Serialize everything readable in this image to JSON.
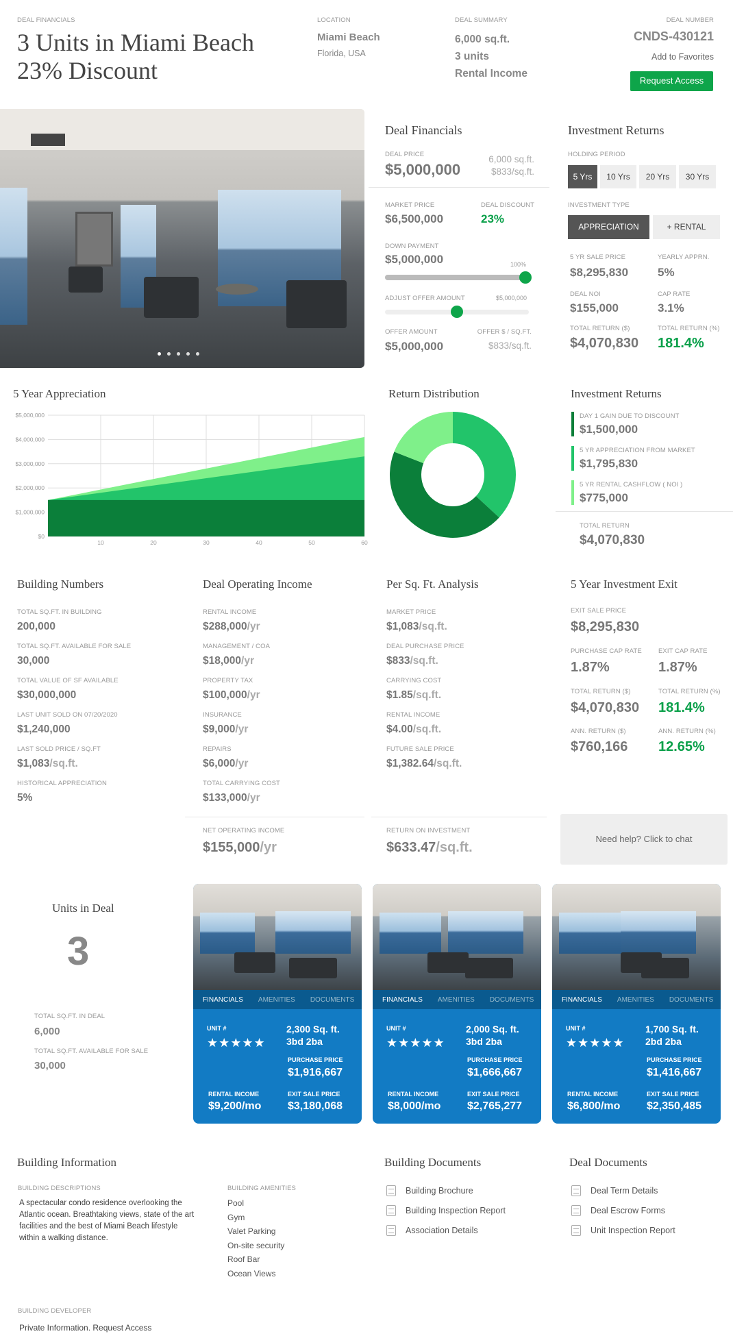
{
  "header": {
    "section_label": "DEAL FINANCIALS",
    "title_line1": "3 Units in Miami Beach",
    "title_line2": "23% Discount",
    "location_label": "LOCATION",
    "location_city": "Miami Beach",
    "location_region": "Florida, USA",
    "summary_label": "DEAL SUMMARY",
    "summary_sqft": "6,000 sq.ft.",
    "summary_units": "3 units",
    "summary_type": "Rental Income",
    "deal_number_label": "DEAL NUMBER",
    "deal_number": "CNDS-430121",
    "favorites_link": "Add to Favorites",
    "request_access": "Request Access"
  },
  "deal_financials": {
    "title": "Deal Financials",
    "deal_price_label": "DEAL PRICE",
    "deal_price": "$5,000,000",
    "sqft": "6,000 sq.ft.",
    "per_sqft": "$833/sq.ft.",
    "market_price_label": "MARKET PRICE",
    "market_price": "$6,500,000",
    "discount_label": "DEAL DISCOUNT",
    "discount": "23%",
    "down_payment_label": "DOWN PAYMENT",
    "down_payment": "$5,000,000",
    "down_payment_pct": "100%",
    "down_payment_level": 1.0,
    "adjust_offer_label": "ADJUST OFFER AMOUNT",
    "adjust_offer_max": "$5,000,000",
    "adjust_offer_level": 0.5,
    "offer_amount_label": "OFFER AMOUNT",
    "offer_amount": "$5,000,000",
    "offer_per_sqft_label": "OFFER $ / SQ.FT.",
    "offer_per_sqft": "$833/sq.ft."
  },
  "investment_returns": {
    "title": "Investment Returns",
    "holding_label": "HOLDING PERIOD",
    "holding_options": [
      "5 Yrs",
      "10 Yrs",
      "20 Yrs",
      "30 Yrs"
    ],
    "type_label": "INVESTMENT TYPE",
    "type_options": [
      "APPRECIATION",
      "+ RENTAL"
    ],
    "sale_price_label": "5 YR SALE PRICE",
    "sale_price": "$8,295,830",
    "yearly_appr_label": "YEARLY APPRN.",
    "yearly_appr": "5%",
    "noi_label": "DEAL NOI",
    "noi": "$155,000",
    "cap_rate_label": "CAP RATE",
    "cap_rate": "3.1%",
    "total_return_label": "TOTAL RETURN ($)",
    "total_return": "$4,070,830",
    "total_return_pct_label": "TOTAL RETURN (%)",
    "total_return_pct": "181.4%"
  },
  "appreciation_chart": {
    "title": "5 Year Appreciation"
  },
  "chart_data": [
    {
      "type": "area",
      "title": "5 Year Appreciation",
      "x": [
        0,
        60
      ],
      "xticks": [
        "10",
        "20",
        "30",
        "40",
        "50",
        "60"
      ],
      "yticks": [
        "$0",
        "$1,000,000",
        "$2,000,000",
        "$3,000,000",
        "$4,000,000",
        "$5,000,000"
      ],
      "ylim": [
        0,
        5000000
      ],
      "xlim": [
        0,
        60
      ],
      "series": [
        {
          "values": [
            1500000,
            1500000
          ],
          "color": "#0b7f3a"
        },
        {
          "values": [
            1500000,
            3300000
          ],
          "color": "#22c46a"
        },
        {
          "values": [
            1500000,
            4100000
          ],
          "color": "#7ff08a"
        }
      ],
      "grid": true
    },
    {
      "type": "pie",
      "title": "Return Distribution",
      "values": [
        1500000,
        1795830,
        775000
      ],
      "colors": [
        "#22c46a",
        "#0b7f3a",
        "#7ff08a"
      ]
    }
  ],
  "return_distribution": {
    "title": "Return Distribution"
  },
  "returns_breakdown": {
    "title": "Investment Returns",
    "items": [
      {
        "label": "DAY 1 GAIN DUE TO DISCOUNT",
        "value": "$1,500,000",
        "color": "#0b7f3a"
      },
      {
        "label": "5 YR APPRECIATION FROM MARKET",
        "value": "$1,795,830",
        "color": "#22c46a"
      },
      {
        "label": "5 YR RENTAL CASHFLOW ( NOI )",
        "value": "$775,000",
        "color": "#7ff08a"
      }
    ],
    "total_label": "TOTAL RETURN",
    "total": "$4,070,830"
  },
  "building_numbers": {
    "title": "Building Numbers",
    "items": [
      {
        "label": "TOTAL SQ.FT. IN BUILDING",
        "value": "200,000",
        "unit": ""
      },
      {
        "label": "TOTAL SQ.FT. AVAILABLE FOR SALE",
        "value": "30,000",
        "unit": ""
      },
      {
        "label": "TOTAL VALUE OF SF AVAILABLE",
        "value": "$30,000,000",
        "unit": ""
      },
      {
        "label": "LAST UNIT SOLD ON 07/20/2020",
        "value": "$1,240,000",
        "unit": ""
      },
      {
        "label": "LAST SOLD PRICE / SQ.FT",
        "value": "$1,083",
        "unit": "/sq.ft."
      },
      {
        "label": "HISTORICAL APPRECIATION",
        "value": "5%",
        "unit": ""
      }
    ]
  },
  "operating_income": {
    "title": "Deal Operating Income",
    "items": [
      {
        "label": "RENTAL INCOME",
        "value": "$288,000",
        "unit": "/yr"
      },
      {
        "label": "MANAGEMENT / COA",
        "value": "$18,000",
        "unit": "/yr"
      },
      {
        "label": "PROPERTY TAX",
        "value": "$100,000",
        "unit": "/yr"
      },
      {
        "label": "INSURANCE",
        "value": "$9,000",
        "unit": "/yr"
      },
      {
        "label": "REPAIRS",
        "value": "$6,000",
        "unit": "/yr"
      },
      {
        "label": "TOTAL CARRYING COST",
        "value": "$133,000",
        "unit": "/yr"
      }
    ],
    "noi_label": "NET OPERATING INCOME",
    "noi": "$155,000",
    "noi_unit": "/yr"
  },
  "sqft_analysis": {
    "title": "Per Sq. Ft. Analysis",
    "items": [
      {
        "label": "MARKET PRICE",
        "value": "$1,083",
        "unit": "/sq.ft."
      },
      {
        "label": "DEAL PURCHASE PRICE",
        "value": "$833",
        "unit": "/sq.ft."
      },
      {
        "label": "CARRYING COST",
        "value": "$1.85",
        "unit": "/sq.ft."
      },
      {
        "label": "RENTAL INCOME",
        "value": "$4.00",
        "unit": "/sq.ft."
      },
      {
        "label": "FUTURE SALE PRICE",
        "value": "$1,382.64",
        "unit": "/sq.ft."
      }
    ],
    "roi_label": "RETURN ON INVESTMENT",
    "roi": "$633.47",
    "roi_unit": "/sq.ft."
  },
  "exit": {
    "title": "5 Year Investment Exit",
    "exit_price_label": "EXIT SALE PRICE",
    "exit_price": "$8,295,830",
    "purchase_cap_label": "PURCHASE CAP RATE",
    "purchase_cap": "1.87%",
    "exit_cap_label": "EXIT CAP RATE",
    "exit_cap": "1.87%",
    "total_return_label": "TOTAL RETURN ($)",
    "total_return": "$4,070,830",
    "total_return_pct_label": "TOTAL RETURN (%)",
    "total_return_pct": "181.4%",
    "ann_return_label": "ANN. RETURN ($)",
    "ann_return": "$760,166",
    "ann_return_pct_label": "ANN. RETURN (%)",
    "ann_return_pct": "12.65%"
  },
  "chat": {
    "label": "Need help? Click to chat"
  },
  "units": {
    "title": "Units in Deal",
    "count": "3",
    "sqft_label": "TOTAL SQ.FT. IN DEAL",
    "sqft": "6,000",
    "available_label": "TOTAL SQ.FT. AVAILABLE FOR SALE",
    "available": "30,000",
    "tabs": [
      "FINANCIALS",
      "AMENITIES",
      "DOCUMENTS"
    ],
    "unit_label": "UNIT #",
    "stars": "★★★★★",
    "purchase_label": "PURCHASE PRICE",
    "rental_label": "RENTAL INCOME",
    "exit_label": "EXIT SALE PRICE",
    "cards": [
      {
        "size": "2,300 Sq. ft.",
        "rooms": "3bd 2ba",
        "purchase": "$1,916,667",
        "rental": "$9,200/mo",
        "exit": "$3,180,068"
      },
      {
        "size": "2,000 Sq. ft.",
        "rooms": "3bd 2ba",
        "purchase": "$1,666,667",
        "rental": "$8,000/mo",
        "exit": "$2,765,277"
      },
      {
        "size": "1,700 Sq. ft.",
        "rooms": "2bd 2ba",
        "purchase": "$1,416,667",
        "rental": "$6,800/mo",
        "exit": "$2,350,485"
      }
    ]
  },
  "building_info": {
    "title": "Building Information",
    "desc_label": "BUILDING DESCRIPTIONS",
    "desc": "A spectacular condo residence overlooking the Atlantic ocean. Breathtaking views, state of the art facilities and the best of Miami Beach lifestyle within a walking distance.",
    "amenities_label": "BUILDING AMENITIES",
    "amenities": [
      "Pool",
      "Gym",
      "Valet Parking",
      "On-site security",
      "Roof Bar",
      "Ocean Views"
    ],
    "developer_label": "BUILDING DEVELOPER",
    "developer": "Private Information. Request Access"
  },
  "building_docs": {
    "title": "Building Documents",
    "items": [
      "Building Brochure",
      "Building Inspection Report",
      "Association Details"
    ]
  },
  "deal_docs": {
    "title": "Deal Documents",
    "items": [
      "Deal Term Details",
      "Deal Escrow Forms",
      "Unit Inspection Report"
    ]
  }
}
